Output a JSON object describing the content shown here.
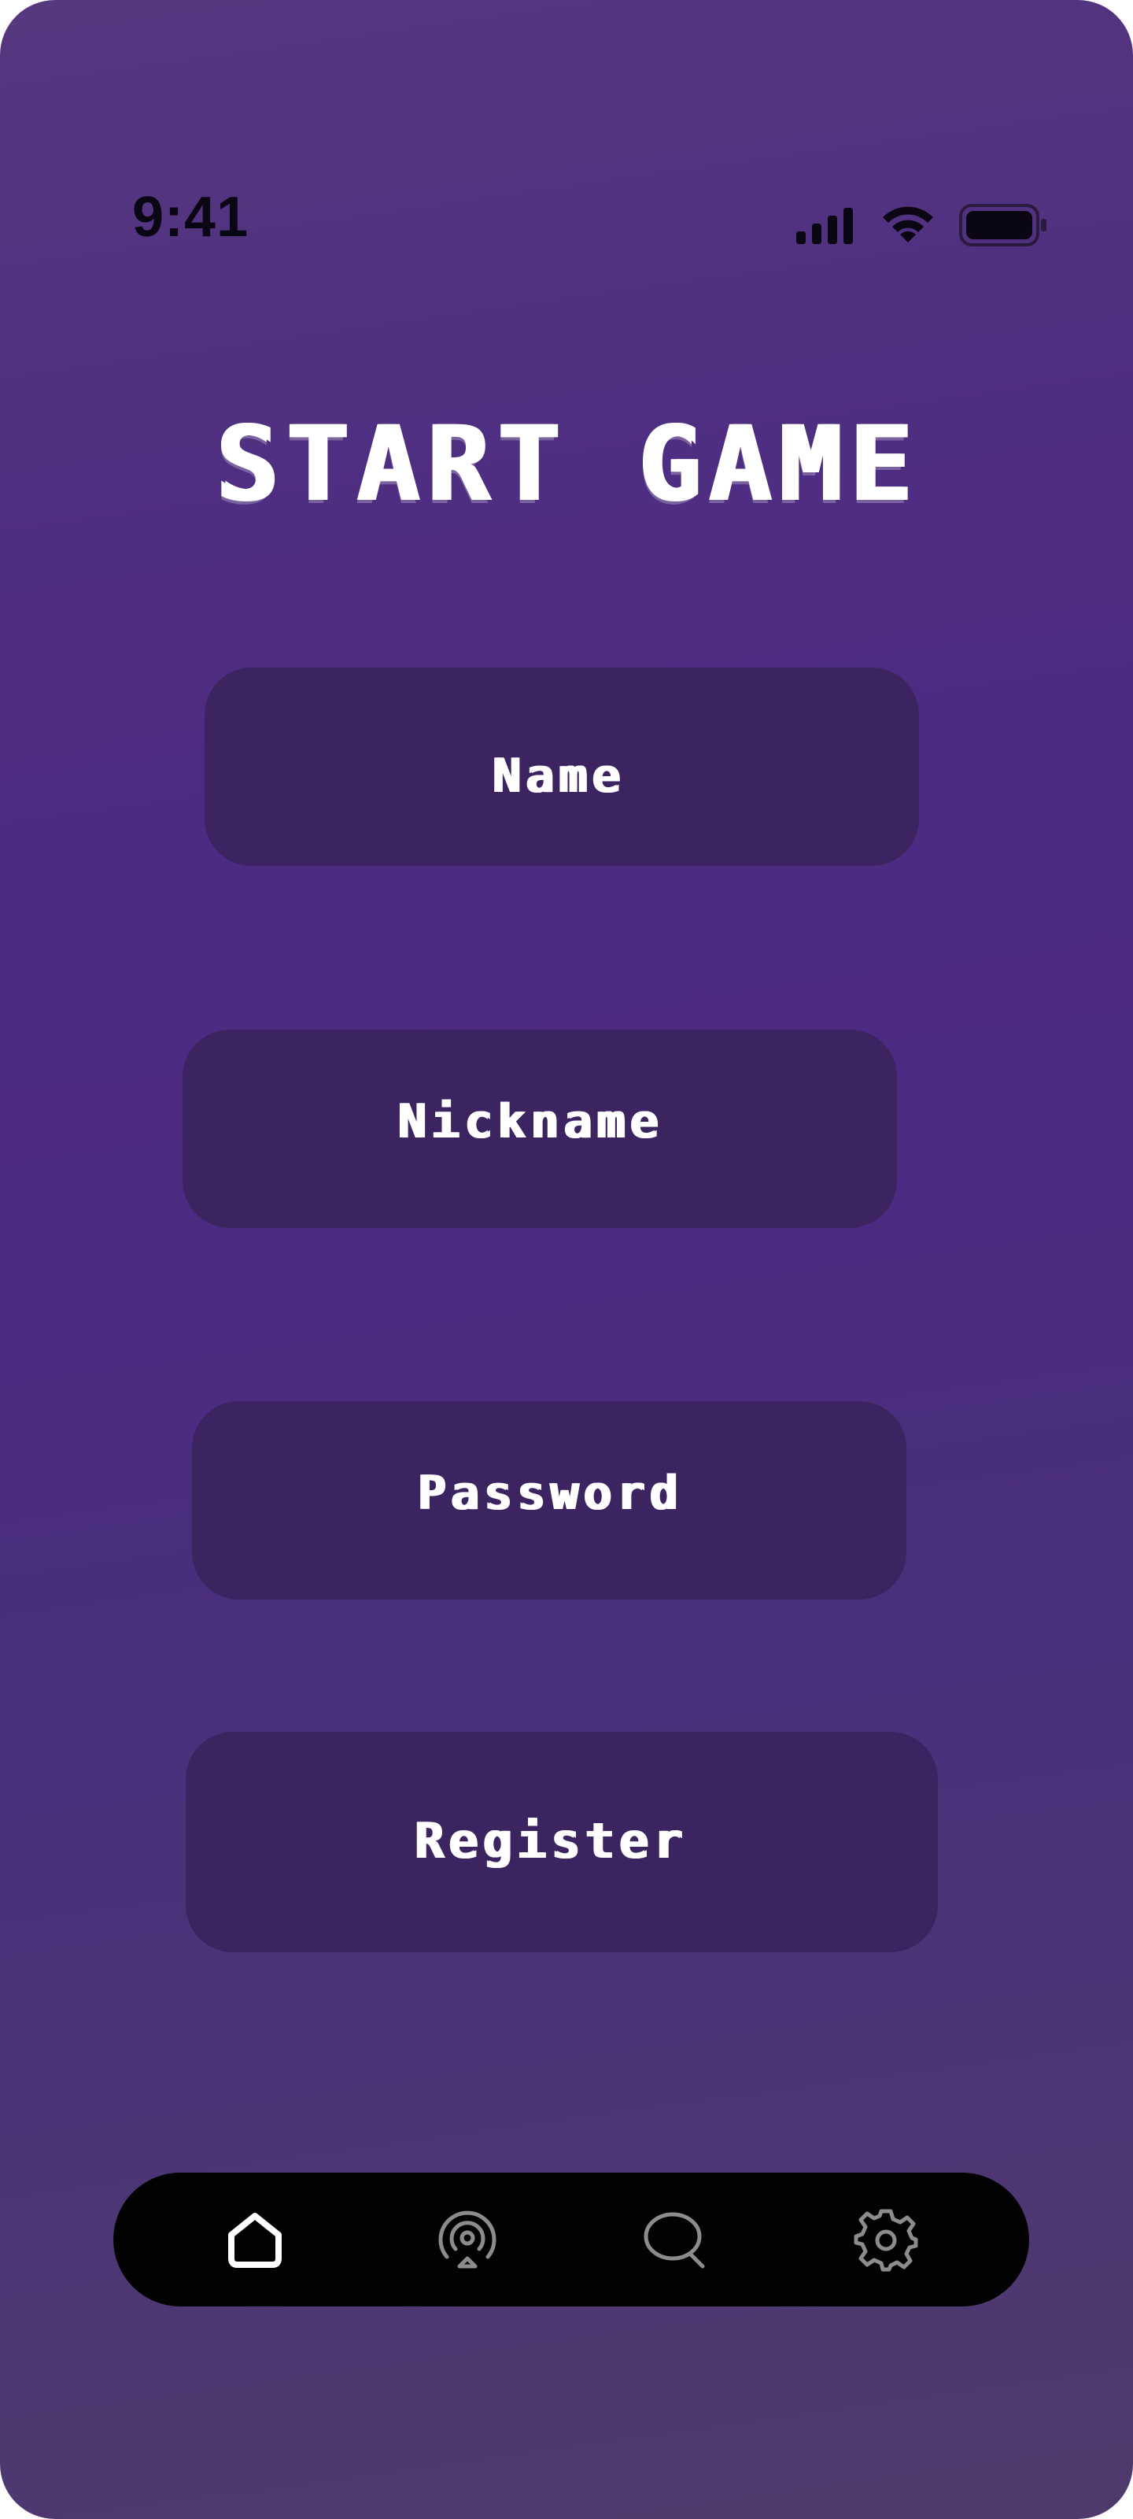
{
  "status_bar": {
    "time": "9:41",
    "icons": [
      "cellular-signal-icon",
      "wifi-icon",
      "battery-icon"
    ]
  },
  "title": "START GAME",
  "form": {
    "name_label": "Name",
    "nickname_label": "Nickname",
    "password_label": "Password",
    "register_label": "Register"
  },
  "bottom_nav": {
    "items": [
      {
        "icon": "home-icon",
        "active": true
      },
      {
        "icon": "broadcast-icon",
        "active": false
      },
      {
        "icon": "chat-icon",
        "active": false
      },
      {
        "icon": "settings-icon",
        "active": false
      }
    ]
  },
  "colors": {
    "background_top": "#55387e",
    "background_mid": "#4b2a82",
    "background_bottom": "#503a6c",
    "pill": "#3b2460",
    "nav_bar": "#030203",
    "active_icon": "#ffffff",
    "inactive_icon": "#8c8c8c"
  }
}
